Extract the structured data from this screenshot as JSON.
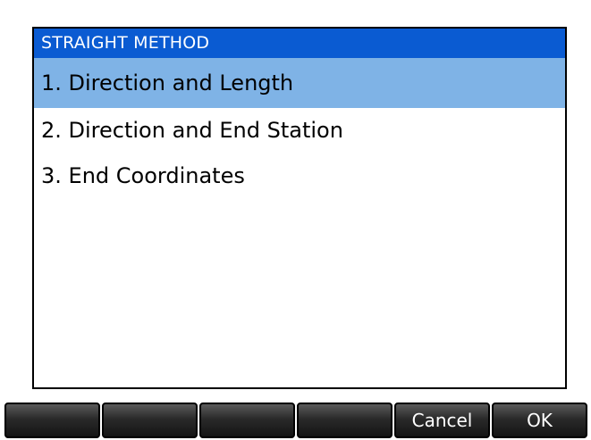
{
  "dialog": {
    "title": "STRAIGHT METHOD",
    "options": [
      {
        "label": "1. Direction and Length",
        "selected": true
      },
      {
        "label": "2. Direction and End Station",
        "selected": false
      },
      {
        "label": "3. End Coordinates",
        "selected": false
      }
    ]
  },
  "softkeys": {
    "key1": "",
    "key2": "",
    "key3": "",
    "key4": "",
    "cancel": "Cancel",
    "ok": "OK"
  },
  "colors": {
    "title_bar": "#0a5bd2",
    "selected_row": "#7fb3e6",
    "softkey": "#2a2a2a"
  }
}
